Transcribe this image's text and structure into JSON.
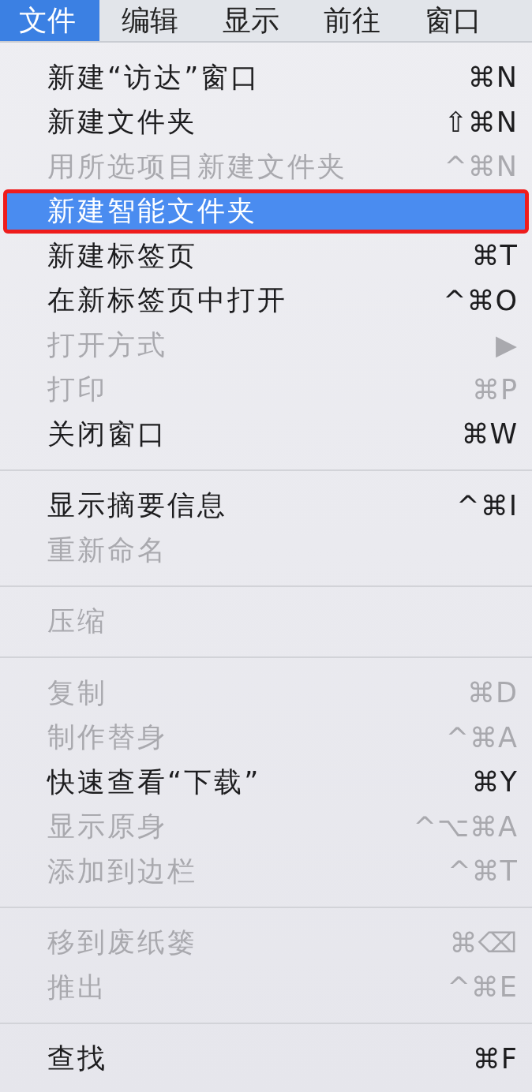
{
  "menu_bar": [
    {
      "label": "文件",
      "selected": true
    },
    {
      "label": "编辑",
      "selected": false
    },
    {
      "label": "显示",
      "selected": false
    },
    {
      "label": "前往",
      "selected": false
    },
    {
      "label": "窗口",
      "selected": false
    }
  ],
  "menu_sections": [
    {
      "items": [
        {
          "label": "新建“访达”窗口",
          "shortcut": "⌘N",
          "disabled": false,
          "selected": false,
          "outlined": false
        },
        {
          "label": "新建文件夹",
          "shortcut": "⇧⌘N",
          "disabled": false,
          "selected": false,
          "outlined": false
        },
        {
          "label": "用所选项目新建文件夹",
          "shortcut": "^⌘N",
          "disabled": true,
          "selected": false,
          "outlined": false
        },
        {
          "label": "新建智能文件夹",
          "disabled": false,
          "selected": true,
          "outlined": true
        },
        {
          "label": "新建标签页",
          "shortcut": "⌘T",
          "disabled": false,
          "selected": false,
          "outlined": false
        },
        {
          "label": "在新标签页中打开",
          "shortcut": "^⌘O",
          "disabled": false,
          "selected": false,
          "outlined": false
        },
        {
          "label": "打开方式",
          "shortcut": "▶",
          "disabled": true,
          "selected": false,
          "outlined": false
        },
        {
          "label": "打印",
          "shortcut": "⌘P",
          "disabled": true,
          "selected": false,
          "outlined": false
        },
        {
          "label": "关闭窗口",
          "shortcut": "⌘W",
          "disabled": false,
          "selected": false,
          "outlined": false
        }
      ]
    },
    {
      "items": [
        {
          "label": "显示摘要信息",
          "shortcut": "^⌘I",
          "disabled": false,
          "selected": false,
          "outlined": false
        },
        {
          "label": "重新命名",
          "disabled": true,
          "selected": false,
          "outlined": false
        }
      ]
    },
    {
      "items": [
        {
          "label": "压缩",
          "disabled": true,
          "selected": false,
          "outlined": false
        }
      ]
    },
    {
      "items": [
        {
          "label": "复制",
          "shortcut": "⌘D",
          "disabled": true,
          "selected": false,
          "outlined": false
        },
        {
          "label": "制作替身",
          "shortcut": "^⌘A",
          "disabled": true,
          "selected": false,
          "outlined": false
        },
        {
          "label": "快速查看“下载”",
          "shortcut": "⌘Y",
          "disabled": false,
          "selected": false,
          "outlined": false
        },
        {
          "label": "显示原身",
          "shortcut": "^⌥⌘A",
          "disabled": true,
          "selected": false,
          "outlined": false
        },
        {
          "label": "添加到边栏",
          "shortcut": "^⌘T",
          "disabled": true,
          "selected": false,
          "outlined": false
        }
      ]
    },
    {
      "items": [
        {
          "label": "移到废纸篓",
          "shortcut": "⌘⌫",
          "disabled": true,
          "selected": false,
          "outlined": false
        },
        {
          "label": "推出",
          "shortcut": "^⌘E",
          "disabled": true,
          "selected": false,
          "outlined": false
        }
      ]
    },
    {
      "items": [
        {
          "label": "查找",
          "shortcut": "⌘F",
          "disabled": false,
          "selected": false,
          "outlined": false
        }
      ]
    }
  ]
}
